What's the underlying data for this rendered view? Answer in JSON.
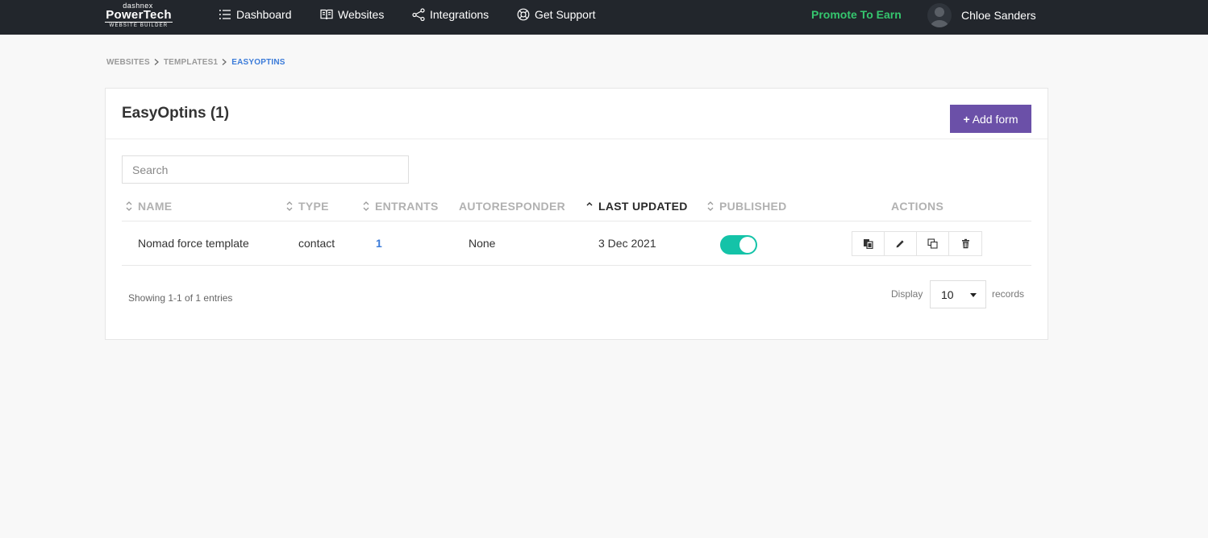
{
  "topnav": {
    "logo": {
      "top": "dashnex",
      "main": "PowerTech",
      "sub": "WEBSITE BUILDER"
    },
    "items": [
      {
        "label": "Dashboard",
        "icon": "list-icon"
      },
      {
        "label": "Websites",
        "icon": "book-icon"
      },
      {
        "label": "Integrations",
        "icon": "share-icon"
      },
      {
        "label": "Get Support",
        "icon": "lifebuoy-icon"
      }
    ],
    "promote": "Promote To Earn",
    "user_name": "Chloe Sanders",
    "promote_color": "#35c66e"
  },
  "breadcrumb": [
    {
      "label": "WEBSITES"
    },
    {
      "label": "TEMPLATES1"
    },
    {
      "label": "EASYOPTINS"
    }
  ],
  "card": {
    "title": "EasyOptins (1)",
    "add_button": {
      "plus": "+",
      "label": "Add form"
    },
    "accent_color": "#6b50a8"
  },
  "search": {
    "placeholder": "Search",
    "value": ""
  },
  "table": {
    "columns": [
      {
        "label": "NAME",
        "sortable": true
      },
      {
        "label": "TYPE",
        "sortable": true
      },
      {
        "label": "ENTRANTS",
        "sortable": true
      },
      {
        "label": "AUTORESPONDER",
        "sortable": false
      },
      {
        "label": "LAST UPDATED",
        "sortable": true,
        "sorted": "asc"
      },
      {
        "label": "PUBLISHED",
        "sortable": true
      },
      {
        "label": "ACTIONS",
        "sortable": false
      }
    ],
    "rows": [
      {
        "name": "Nomad force template",
        "type": "contact",
        "entrants": "1",
        "autoresponder": "None",
        "last_updated": "3 Dec 2021",
        "published": true,
        "actions": [
          "paste-icon",
          "pencil-icon",
          "copy-icon",
          "trash-icon"
        ]
      }
    ],
    "toggle_color": "#14c3a8"
  },
  "footer": {
    "showing": "Showing 1-1 of 1 entries",
    "display_label": "Display",
    "records_label": "records",
    "page_size": "10"
  }
}
